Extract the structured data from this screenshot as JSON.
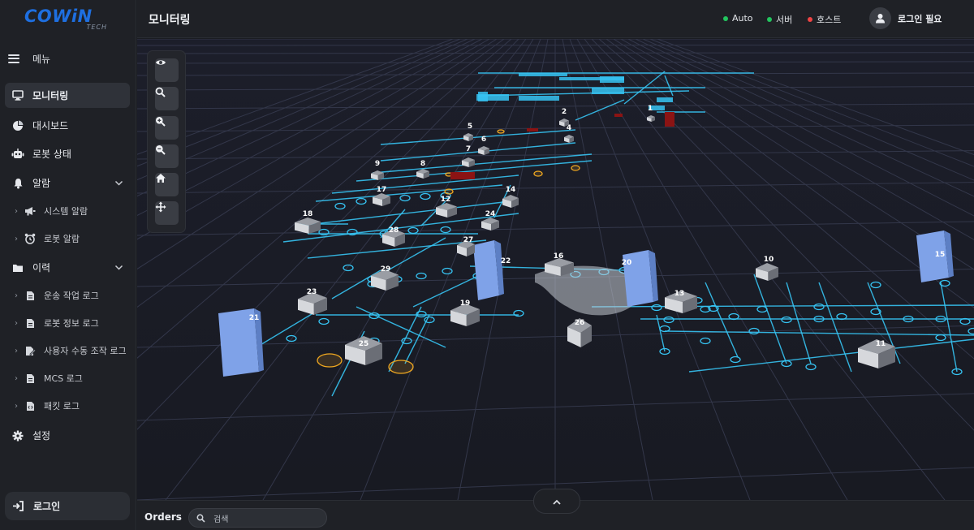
{
  "app": {
    "logo_text": "COWiN",
    "logo_sub": "TECH"
  },
  "sidebar": {
    "menu_label": "메뉴",
    "items": [
      {
        "label": "모니터링",
        "icon": "monitor-icon",
        "active": true
      },
      {
        "label": "대시보드",
        "icon": "pie-chart-icon"
      },
      {
        "label": "로봇 상태",
        "icon": "robot-icon"
      },
      {
        "label": "알람",
        "icon": "bell-icon",
        "expandable": true
      },
      {
        "label": "이력",
        "icon": "folder-icon",
        "expandable": true
      },
      {
        "label": "설정",
        "icon": "gear-icon"
      }
    ],
    "alarm_children": [
      {
        "label": "시스템 알람",
        "icon": "megaphone-icon"
      },
      {
        "label": "로봇 알람",
        "icon": "alarm-clock-icon"
      }
    ],
    "history_children": [
      {
        "label": "운송 작업 로그",
        "icon": "file-icon"
      },
      {
        "label": "로봇 정보 로그",
        "icon": "file-icon"
      },
      {
        "label": "사용자 수동 조작 로그",
        "icon": "file-edit-icon"
      },
      {
        "label": "MCS 로그",
        "icon": "file-icon"
      },
      {
        "label": "패킷 로그",
        "icon": "file-code-icon"
      }
    ],
    "login_label": "로그인"
  },
  "header": {
    "title": "모니터링",
    "status": [
      {
        "label": "Auto",
        "color": "#22c55e"
      },
      {
        "label": "서버",
        "color": "#22c55e"
      },
      {
        "label": "호스트",
        "color": "#ef4444"
      }
    ],
    "user_label": "로그인 필요"
  },
  "toolbar": {
    "tools": [
      "eye-icon",
      "search-icon",
      "zoom-in-icon",
      "zoom-out-icon",
      "home-icon",
      "move-icon"
    ]
  },
  "map": {
    "robot_labels": [
      "1",
      "2",
      "4",
      "5",
      "6",
      "7",
      "8",
      "9",
      "10",
      "11",
      "12",
      "13",
      "14",
      "15",
      "16",
      "17",
      "18",
      "19",
      "20",
      "21",
      "22",
      "23",
      "24",
      "25",
      "26",
      "27",
      "28",
      "29"
    ],
    "colors": {
      "track": "#36c3f2",
      "robot_body": "#6b6e76",
      "tower": "#7fa2e8",
      "alert": "#8b1313",
      "marker": "#f0a820"
    }
  },
  "bottombar": {
    "orders_label": "Orders",
    "search_placeholder": "검색"
  }
}
